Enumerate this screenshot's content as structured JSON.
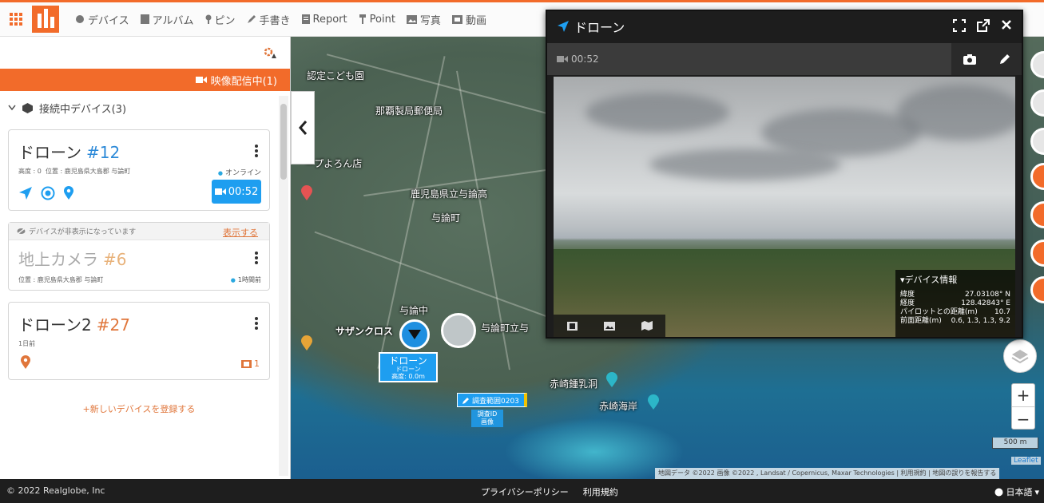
{
  "nav": {
    "items": [
      {
        "label": "デバイス",
        "icon": "device-icon"
      },
      {
        "label": "アルバム",
        "icon": "album-icon"
      },
      {
        "label": "ピン",
        "icon": "pin-icon"
      },
      {
        "label": "手書き",
        "icon": "pencil-icon"
      },
      {
        "label": "Report",
        "icon": "report-icon"
      },
      {
        "label": "Point",
        "icon": "point-icon"
      },
      {
        "label": "写真",
        "icon": "photo-icon"
      },
      {
        "label": "動画",
        "icon": "video-icon"
      }
    ]
  },
  "sidebar": {
    "live_label": "映像配信中(1)",
    "connected_label": "接続中デバイス(3)",
    "devices": [
      {
        "name": "ドローン",
        "number": "#12",
        "altitude": "高度 : 0",
        "location": "位置 : 鹿児島県大島郡 与論町",
        "status": "オンライン",
        "rec_time": "00:52"
      },
      {
        "hidden_notice": "デバイスが非表示になっています",
        "show_label": "表示する",
        "name": "地上カメラ",
        "number": "#6",
        "location": "位置 : 鹿児島県大島郡 与論町",
        "last_seen": "1時間前"
      },
      {
        "name": "ドローン2",
        "number": "#27",
        "last_seen": "1日前",
        "media_count": "1"
      }
    ],
    "add_device_label": "新しいデバイスを登録する"
  },
  "map": {
    "labels": [
      {
        "text": "認定こども園",
        "cls": "l1"
      },
      {
        "text": "那覇製局郵便局",
        "cls": "l2"
      },
      {
        "text": "ープよろん店",
        "cls": "l3"
      },
      {
        "text": "鹿児島県立与論高",
        "cls": "l4"
      },
      {
        "text": "与論町",
        "cls": "l5"
      },
      {
        "text": "与論中",
        "cls": "l6"
      },
      {
        "text": "サザンクロス",
        "cls": "l7"
      },
      {
        "text": "与論町立与",
        "cls": "l8"
      },
      {
        "text": "赤崎鍾乳洞",
        "cls": "l9"
      },
      {
        "text": "赤崎海岸",
        "cls": "l10"
      }
    ],
    "drone_tag": {
      "name": "ドローン",
      "sub": "ドローン",
      "alt": "高度: 0.0m"
    },
    "survey_tag": "調査範囲0203",
    "survey_sub": "調査ID\n画像",
    "scale": "500 m",
    "attribution": "地図データ ©2022 画像 ©2022 , Landsat / Copernicus, Maxar Technologies | 利用規約 | 地図の誤りを報告する",
    "leaflet": "Leaflet",
    "zoom_in": "+",
    "zoom_out": "−"
  },
  "video_window": {
    "title": "ドローン",
    "elapsed": "00:52",
    "device_info": {
      "title": "デバイス情報",
      "rows": [
        {
          "k": "緯度",
          "v": "27.03108° N"
        },
        {
          "k": "経度",
          "v": "128.42843° E"
        },
        {
          "k": "パイロットとの距離(m)",
          "v": "10.7"
        },
        {
          "k": "前面距離(m)",
          "v": "0.6, 1.3, 1.3, 9.2"
        }
      ]
    }
  },
  "footer": {
    "copyright": "© 2022 Realglobe, Inc",
    "privacy": "プライバシーポリシー",
    "terms": "利用規約",
    "language": "日本語"
  },
  "colors": {
    "accent": "#f26b2a",
    "blue": "#1e9ef0"
  }
}
